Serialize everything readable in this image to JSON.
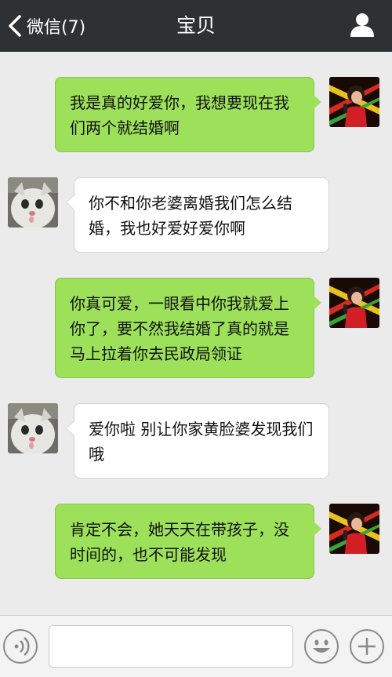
{
  "header": {
    "back_label": "微信(7)",
    "title": "宝贝"
  },
  "messages": [
    {
      "side": "right",
      "avatar": "singer-avatar",
      "text": "我是真的好爱你，我想要现在我们两个就结婚啊"
    },
    {
      "side": "left",
      "avatar": "cat-avatar",
      "text": "你不和你老婆离婚我们怎么结婚，我也好爱好爱你啊"
    },
    {
      "side": "right",
      "avatar": "singer-avatar",
      "text": "你真可爱，一眼看中你我就爱上你了，要不然我结婚了真的就是马上拉着你去民政局领证"
    },
    {
      "side": "left",
      "avatar": "cat-avatar",
      "text": "爱你啦 别让你家黄脸婆发现我们哦"
    },
    {
      "side": "right",
      "avatar": "singer-avatar",
      "text": "肯定不会，她天天在带孩子，没时间的，也不可能发现"
    }
  ],
  "input_bar": {
    "placeholder": "",
    "icons": [
      "voice-icon",
      "emoji-icon",
      "plus-icon"
    ]
  },
  "colors": {
    "header_bg": "#2e3133",
    "chat_bg": "#ebebeb",
    "sent_bubble": "#9de05a",
    "received_bubble": "#ffffff"
  }
}
